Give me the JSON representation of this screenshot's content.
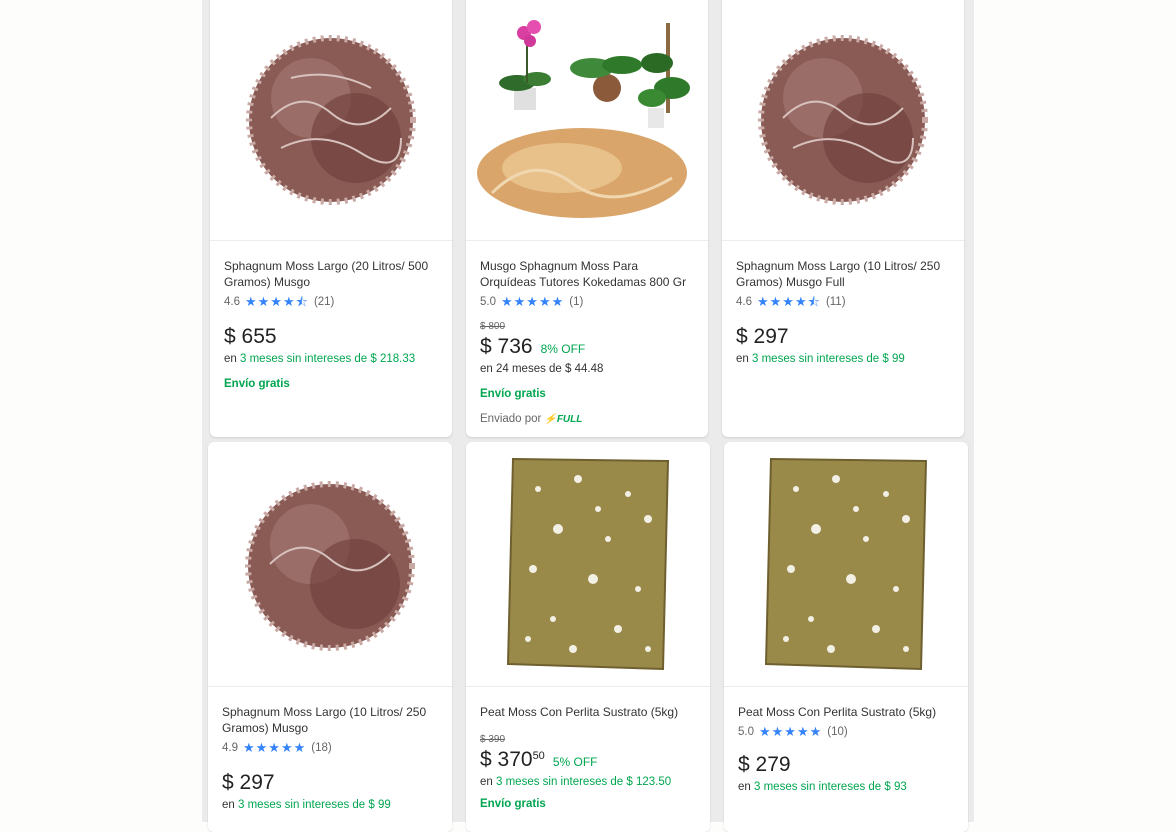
{
  "products": [
    {
      "image": "sphagnum-moss-ball",
      "title": "Sphagnum Moss Largo (20 Litros/ 500 Gramos) Musgo",
      "rating": "4.6",
      "rating_value": 4.6,
      "stars": "★★★★⯪",
      "reviews": "(21)",
      "price": "$ 655",
      "cents": "",
      "installments_prefix": "en ",
      "installments": "3 meses sin intereses de $ 218.33",
      "shipping": "Envío gratis"
    },
    {
      "image": "moss-orchid-plants",
      "title": "Musgo Sphagnum Moss Para Orquídeas Tutores Kokedamas 800 Gr",
      "rating": "5.0",
      "rating_value": 5.0,
      "stars": "★★★★★",
      "reviews": "(1)",
      "old_price": "$ 800",
      "price": "$ 736",
      "cents": "",
      "discount": "8% OFF",
      "installments_prefix": "en 24 meses de $ 44.48",
      "installments": "",
      "shipping": "Envío gratis",
      "fulfillment_prefix": "Enviado por",
      "fulfillment_badge": "FULL"
    },
    {
      "image": "sphagnum-moss-ball",
      "title": "Sphagnum Moss Largo (10 Litros/ 250 Gramos) Musgo Full",
      "rating": "4.6",
      "rating_value": 4.6,
      "stars": "★★★★⯪",
      "reviews": "(11)",
      "price": "$ 297",
      "cents": "",
      "installments_prefix": "en ",
      "installments": "3 meses sin intereses de $ 99"
    },
    {
      "image": "sphagnum-moss-ball",
      "title": "Sphagnum Moss Largo (10 Litros/ 250 Gramos) Musgo",
      "rating": "4.9",
      "rating_value": 4.9,
      "stars": "★★★★★",
      "reviews": "(18)",
      "price": "$ 297",
      "cents": "",
      "installments_prefix": "en ",
      "installments": "3 meses sin intereses de $ 99"
    },
    {
      "image": "peat-moss-perlite",
      "title": "Peat Moss Con Perlita Sustrato (5kg)",
      "old_price": "$ 390",
      "price": "$ 370",
      "cents": "50",
      "discount": "5% OFF",
      "installments_prefix": "en ",
      "installments": "3 meses sin intereses de $ 123.50",
      "shipping": "Envío gratis"
    },
    {
      "image": "peat-moss-perlite",
      "title": "Peat Moss Con Perlita Sustrato (5kg)",
      "rating": "5.0",
      "rating_value": 5.0,
      "stars": "★★★★★",
      "reviews": "(10)",
      "price": "$ 279",
      "cents": "",
      "installments_prefix": "en ",
      "installments": "3 meses sin intereses de $ 93"
    }
  ],
  "colors": {
    "accent_star": "#3483fa",
    "green": "#00a650",
    "background": "#ebebeb"
  }
}
